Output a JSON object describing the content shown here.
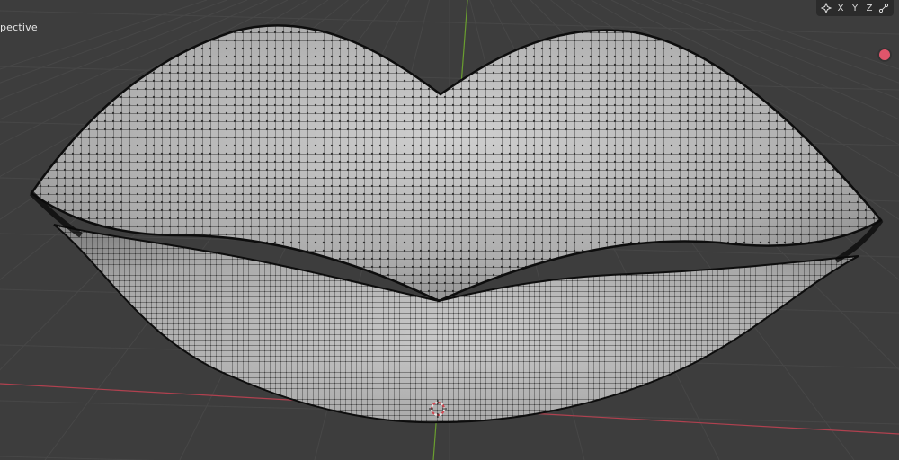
{
  "viewport": {
    "view_label": "pective",
    "colors": {
      "background": "#3d3d3d",
      "grid_line": "#474747",
      "x_axis": "#b0414f",
      "y_axis": "#6a9f2f",
      "mesh_fill": "#b8b8b8",
      "wire": "#141414",
      "record": "#e0556b"
    }
  },
  "axis_toolbar": {
    "icon": "orientation-gizmo-icon",
    "x_label": "X",
    "y_label": "Y",
    "z_label": "Z",
    "snap_icon": "snap-node-icon"
  },
  "scene": {
    "object": "lips-mesh",
    "cursor_icon": "3d-cursor-icon",
    "record_icon": "record-dot-icon"
  }
}
